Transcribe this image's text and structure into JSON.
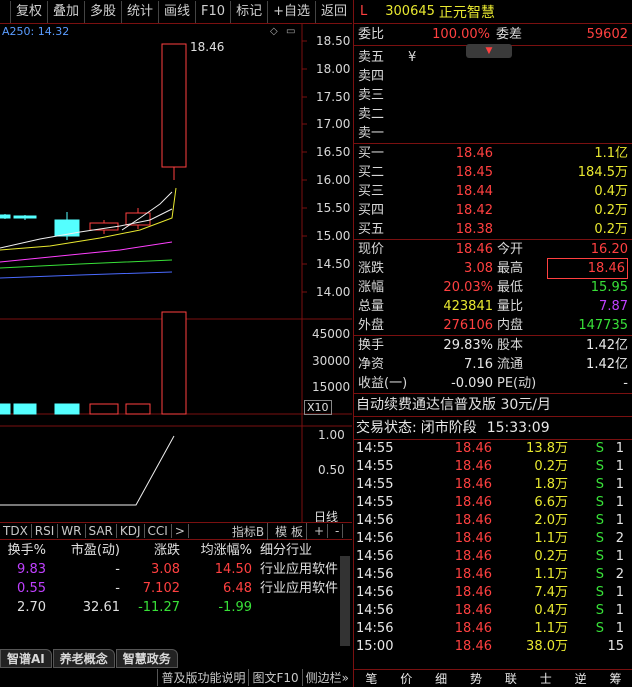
{
  "toolbar": {
    "buttons": [
      "复权",
      "叠加",
      "多股",
      "统计",
      "画线",
      "F10",
      "标记",
      "+自选",
      "返回"
    ]
  },
  "chart": {
    "ma_label": "A250: 14.32",
    "high_label": "18.46",
    "y_ticks": [
      "18.50",
      "18.00",
      "17.50",
      "17.00",
      "16.50",
      "16.00",
      "15.50",
      "15.00",
      "14.50",
      "14.00"
    ],
    "vol_ticks": [
      "45000",
      "30000",
      "15000"
    ],
    "vol_unit": "X10",
    "ind_ticks": [
      "1.00",
      "0.50"
    ],
    "ind_label": "日线"
  },
  "indicator_tabs": [
    "TDX",
    "RSI",
    "WR",
    "SAR",
    "KDJ",
    "CCI",
    ">",
    "指标B",
    "模 板",
    "+",
    "-"
  ],
  "table": {
    "headers": [
      "换手%",
      "市盈(动)",
      "涨跌",
      "均涨幅%",
      "细分行业"
    ],
    "rows": [
      {
        "turnover": "9.83",
        "pe": "-",
        "change": "3.08",
        "avg": "14.50",
        "industry": "行业应用软件"
      },
      {
        "turnover": "0.55",
        "pe": "-",
        "change": "7.102",
        "avg": "6.48",
        "industry": "行业应用软件"
      },
      {
        "turnover": "2.70",
        "pe": "32.61",
        "change": "-11.27",
        "avg": "-1.99",
        "industry": ""
      }
    ]
  },
  "concept_tabs": [
    "智谱AI",
    "养老概念",
    "智慧政务"
  ],
  "footer": [
    "普及版功能说明",
    "图文F10",
    "侧边栏»"
  ],
  "quote": {
    "market": "L",
    "code": "300645",
    "name": "正元智慧",
    "weibi_label": "委比",
    "weibi": "100.00%",
    "weicha_label": "委差",
    "weicha": "59602",
    "sell": [
      {
        "label": "卖五",
        "price": "",
        "vol": ""
      },
      {
        "label": "卖四",
        "price": "",
        "vol": ""
      },
      {
        "label": "卖三",
        "price": "",
        "vol": ""
      },
      {
        "label": "卖二",
        "price": "",
        "vol": ""
      },
      {
        "label": "卖一",
        "price": "",
        "vol": ""
      }
    ],
    "sell_mark": "¥",
    "buy": [
      {
        "label": "买一",
        "price": "18.46",
        "vol": "1.1亿"
      },
      {
        "label": "买二",
        "price": "18.45",
        "vol": "184.5万"
      },
      {
        "label": "买三",
        "price": "18.44",
        "vol": "0.4万"
      },
      {
        "label": "买四",
        "price": "18.42",
        "vol": "0.2万"
      },
      {
        "label": "买五",
        "price": "18.38",
        "vol": "0.2万"
      }
    ],
    "stats": [
      {
        "l1": "现价",
        "v1": "18.46",
        "l2": "今开",
        "v2": "16.20"
      },
      {
        "l1": "涨跌",
        "v1": "3.08",
        "l2": "最高",
        "v2": "18.46"
      },
      {
        "l1": "涨幅",
        "v1": "20.03%",
        "l2": "最低",
        "v2": "15.95"
      },
      {
        "l1": "总量",
        "v1": "423841",
        "l2": "量比",
        "v2": "7.87"
      },
      {
        "l1": "外盘",
        "v1": "276106",
        "l2": "内盘",
        "v2": "147735"
      }
    ],
    "fund": [
      {
        "l1": "换手",
        "v1": "29.83%",
        "l2": "股本",
        "v2": "1.42亿"
      },
      {
        "l1": "净资",
        "v1": "7.16",
        "l2": "流通",
        "v2": "1.42亿"
      },
      {
        "l1": "收益(一)",
        "v1": "-0.090",
        "l2": "PE(动)",
        "v2": "-"
      }
    ],
    "ad": "自动续费通达信普及版 30元/月",
    "status_label": "交易状态:",
    "status": "闭市阶段",
    "time": "15:33:09"
  },
  "ticks": [
    {
      "t": "14:55",
      "p": "18.46",
      "v": "13.8万",
      "s": "S",
      "n": "1"
    },
    {
      "t": "14:55",
      "p": "18.46",
      "v": "0.2万",
      "s": "S",
      "n": "1"
    },
    {
      "t": "14:55",
      "p": "18.46",
      "v": "1.8万",
      "s": "S",
      "n": "1"
    },
    {
      "t": "14:55",
      "p": "18.46",
      "v": "6.6万",
      "s": "S",
      "n": "1"
    },
    {
      "t": "14:56",
      "p": "18.46",
      "v": "2.0万",
      "s": "S",
      "n": "1"
    },
    {
      "t": "14:56",
      "p": "18.46",
      "v": "1.1万",
      "s": "S",
      "n": "2"
    },
    {
      "t": "14:56",
      "p": "18.46",
      "v": "0.2万",
      "s": "S",
      "n": "1"
    },
    {
      "t": "14:56",
      "p": "18.46",
      "v": "1.1万",
      "s": "S",
      "n": "2"
    },
    {
      "t": "14:56",
      "p": "18.46",
      "v": "7.4万",
      "s": "S",
      "n": "1"
    },
    {
      "t": "14:56",
      "p": "18.46",
      "v": "0.4万",
      "s": "S",
      "n": "1"
    },
    {
      "t": "14:56",
      "p": "18.46",
      "v": "1.1万",
      "s": "S",
      "n": "1"
    },
    {
      "t": "15:00",
      "p": "18.46",
      "v": "38.0万",
      "s": "",
      "n": "15"
    }
  ],
  "nav": [
    "笔",
    "价",
    "细",
    "势",
    "联",
    "士",
    "逆",
    "筹"
  ]
}
